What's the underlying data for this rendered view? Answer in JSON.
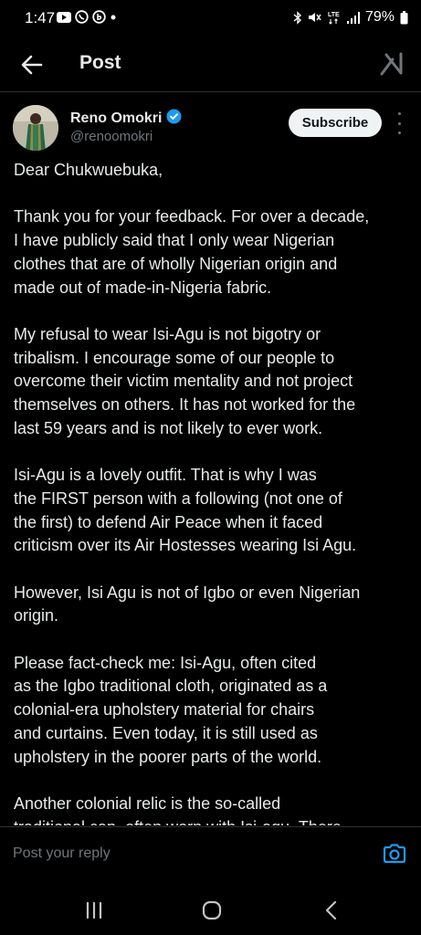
{
  "status_bar": {
    "time": "1:47",
    "left_icons": [
      "youtube-icon",
      "whatsapp-icon",
      "whatsapp-business-icon",
      "dot-icon"
    ],
    "right_icons": [
      "bluetooth-icon",
      "mute-icon",
      "lte-signal-icon",
      "signal-bars-icon"
    ],
    "battery_text": "79%"
  },
  "header": {
    "title": "Post",
    "back_icon": "arrow-left-icon",
    "grok_icon": "grok-icon"
  },
  "author": {
    "name": "Reno Omokri",
    "handle": "@renoomokri",
    "verified": true,
    "verified_color": "#1d9bf0",
    "subscribe_label": "Subscribe"
  },
  "post": {
    "paragraphs": [
      "Dear Chukwuebuka,",
      "Thank you for your feedback. For over a decade,\nI have publicly said that I only wear Nigerian\nclothes that are of wholly Nigerian origin and\nmade out of made-in-Nigeria fabric.",
      "My refusal to wear Isi-Agu is not bigotry or\ntribalism. I encourage some of our people to\novercome their victim mentality and not project\nthemselves on others. It has not worked for the\nlast 59 years and is not likely to ever work.",
      "Isi-Agu is a lovely outfit. That is why I was\nthe FIRST person with a following (not one of\nthe first)  to defend Air Peace when it faced\ncriticism over its Air Hostesses wearing Isi Agu.",
      "However, Isi Agu is not of Igbo or even Nigerian\norigin.",
      "Please fact-check me: Isi-Agu, often cited\nas the Igbo traditional cloth, originated as a\ncolonial-era upholstery material for chairs\nand curtains. Even today, it is still used as\nupholstery in the poorer parts of the world.",
      "Another colonial relic is the so-called\ntraditional cap, often worn with Isi-agu. There"
    ]
  },
  "reply": {
    "placeholder": "Post your reply",
    "camera_icon": "camera-icon",
    "accent": "#1d9bf0"
  },
  "nav_bar": {
    "recents_icon": "recent-apps-icon",
    "home_icon": "home-icon",
    "back_icon": "back-chevron-icon"
  }
}
